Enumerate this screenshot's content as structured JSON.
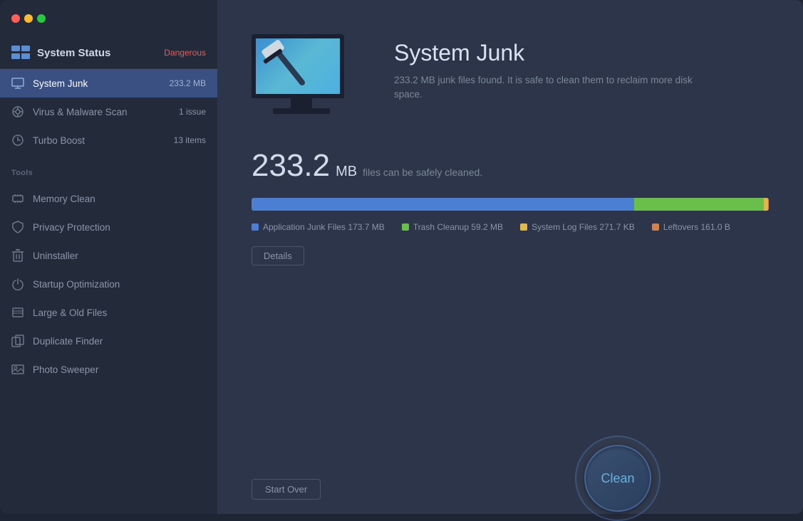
{
  "app": {
    "title": "System Status",
    "status_badge": "Dangerous"
  },
  "sidebar": {
    "tools_label": "Tools",
    "nav_items": [
      {
        "id": "system-junk",
        "label": "System Junk",
        "badge": "233.2 MB",
        "active": true
      },
      {
        "id": "virus-malware",
        "label": "Virus & Malware Scan",
        "badge": "1 issue",
        "active": false
      },
      {
        "id": "turbo-boost",
        "label": "Turbo Boost",
        "badge": "13 items",
        "active": false
      }
    ],
    "tool_items": [
      {
        "id": "memory-clean",
        "label": "Memory Clean"
      },
      {
        "id": "privacy-protection",
        "label": "Privacy Protection"
      },
      {
        "id": "uninstaller",
        "label": "Uninstaller"
      },
      {
        "id": "startup-optimization",
        "label": "Startup Optimization"
      },
      {
        "id": "large-old-files",
        "label": "Large & Old Files"
      },
      {
        "id": "duplicate-finder",
        "label": "Duplicate Finder"
      },
      {
        "id": "photo-sweeper",
        "label": "Photo Sweeper"
      }
    ]
  },
  "main": {
    "title": "System Junk",
    "description": "233.2 MB junk files found.  It is safe to clean them to reclaim more disk space.",
    "size_value": "233.2",
    "size_unit": "MB",
    "size_desc": "files can be safely cleaned.",
    "progress": {
      "blue_pct": 74,
      "green_pct": 25,
      "yellow_pct": 0.5,
      "orange_pct": 0.1
    },
    "legend": [
      {
        "color": "blue",
        "label": "Application Junk Files 173.7 MB"
      },
      {
        "color": "green",
        "label": "Trash Cleanup 59.2 MB"
      },
      {
        "color": "yellow",
        "label": "System Log Files 271.7 KB"
      },
      {
        "color": "orange",
        "label": "Leftovers 161.0 B"
      }
    ],
    "details_button": "Details",
    "clean_button": "Clean",
    "start_over_button": "Start Over"
  },
  "colors": {
    "accent_blue": "#4a7fd4",
    "accent_green": "#6abf4b",
    "accent_yellow": "#e0b84a",
    "accent_orange": "#d4824a",
    "danger": "#e05c5c"
  }
}
